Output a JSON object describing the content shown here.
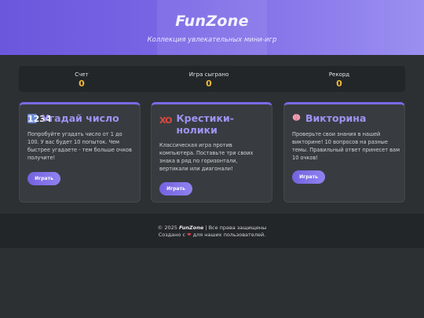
{
  "header": {
    "title": "FunZone",
    "subtitle": "Коллекция увлекательных мини-игр"
  },
  "stats": [
    {
      "label": "Счет",
      "value": "0"
    },
    {
      "label": "Игра сыграно",
      "value": "0"
    },
    {
      "label": "Рекорд",
      "value": "0"
    }
  ],
  "cards": [
    {
      "icon": "number-keycap-icon",
      "icon_text": "1234",
      "title": "Угадай число",
      "description": "Попробуйте угадать число от 1 до 100. У вас будет 10 попыток. Чем быстрее угадаете - тем больше очков получите!",
      "button": "Играть"
    },
    {
      "icon": "tic-tac-toe-xo-icon",
      "icon_text": "XO",
      "title": "Крестики-нолики",
      "description": "Классическая игра против компьютера. Поставьте три своих знака в ряд по горизонтали, вертикали или диагонали!",
      "button": "Играть"
    },
    {
      "icon": "brain-icon",
      "title": "Викторина",
      "description": "Проверьте свои знания в нашей викторине! 10 вопросов на разные темы. Правильный ответ принесет вам 10 очков!",
      "button": "Играть"
    }
  ],
  "footer": {
    "copyright_prefix": "© 2025",
    "brand": "FunZone",
    "copyright_suffix": "| Все права защищены",
    "made_prefix": "Создано с",
    "made_suffix": "для наших пользователей."
  },
  "colors": {
    "accent": "#7b6ae6",
    "stat_value": "#f0b93a",
    "heart": "#d8404c"
  }
}
